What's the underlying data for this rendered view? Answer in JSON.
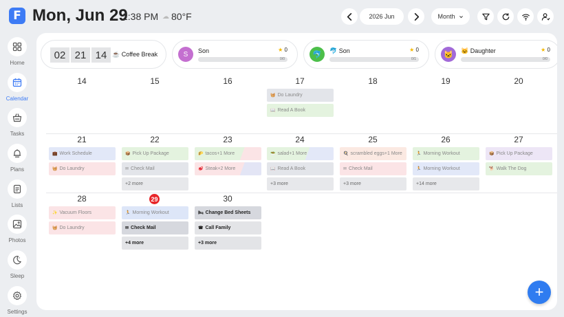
{
  "app": {
    "logo_letter": "F"
  },
  "header": {
    "date": "Mon, Jun 29",
    "time": "2:38 PM",
    "temperature": "80°F",
    "weather_icon": "cloud-icon",
    "month_label": "2026 Jun",
    "view_label": "Month"
  },
  "sidebar": {
    "items": [
      {
        "label": "Home",
        "icon": "grid-icon",
        "active": false
      },
      {
        "label": "Calendar",
        "icon": "calendar-icon",
        "active": true
      },
      {
        "label": "Tasks",
        "icon": "basket-icon",
        "active": false
      },
      {
        "label": "Plans",
        "icon": "bell-icon",
        "active": false
      },
      {
        "label": "Lists",
        "icon": "list-icon",
        "active": false
      },
      {
        "label": "Photos",
        "icon": "photo-icon",
        "active": false
      },
      {
        "label": "Sleep",
        "icon": "moon-icon",
        "active": false
      },
      {
        "label": "Settings",
        "icon": "gear-icon",
        "active": false
      }
    ]
  },
  "timer": {
    "digits": [
      "02",
      "21",
      "14"
    ],
    "label": "☕ Coffee Break"
  },
  "profiles": [
    {
      "initial": "S",
      "name": "Son",
      "stars": "0",
      "progress": "0/0",
      "progress_fraction": 0,
      "color": "#c46fd0"
    },
    {
      "initial": "🐬",
      "name": "🐬 Son",
      "stars": "0",
      "progress": "0/1",
      "progress_fraction": 0,
      "color": "#4cbf4a"
    },
    {
      "initial": "🐱",
      "name": "🐱 Daughter",
      "stars": "0",
      "progress": "0/0",
      "progress_fraction": 0,
      "color": "#a26ad8"
    }
  ],
  "weeks": [
    {
      "days": [
        "14",
        "15",
        "16",
        "17",
        "18",
        "19",
        "20"
      ]
    },
    {
      "days": [
        "21",
        "22",
        "23",
        "24",
        "25",
        "26",
        "27"
      ]
    },
    {
      "days": [
        "28",
        "29",
        "30",
        "",
        "",
        "",
        ""
      ]
    }
  ],
  "today_day": "29",
  "events": [
    {
      "week": 0,
      "day": 3,
      "slot": 0,
      "title": "Do Laundry",
      "icon": "🧺",
      "bg": "#e3e5ea",
      "style": "normal"
    },
    {
      "week": 0,
      "day": 3,
      "slot": 1,
      "title": "Read A Book",
      "icon": "📖",
      "bg": "#e4f3df",
      "style": "normal"
    },
    {
      "week": 1,
      "day": 0,
      "slot": 0,
      "title": "Work Schedule",
      "icon": "💼",
      "bg": "#e2e8f8",
      "style": "normal"
    },
    {
      "week": 1,
      "day": 0,
      "slot": 1,
      "title": "Do Laundry",
      "icon": "🧺",
      "bg": "#fbe4e6",
      "style": "normal"
    },
    {
      "week": 1,
      "day": 1,
      "slot": 0,
      "title": "Pick Up Package",
      "icon": "📦",
      "bg": "#e4f3df",
      "style": "normal"
    },
    {
      "week": 1,
      "day": 1,
      "slot": 1,
      "title": "Check Mail",
      "icon": "✉",
      "bg": "#e3e5ea",
      "style": "normal"
    },
    {
      "week": 1,
      "day": 1,
      "slot": 2,
      "title": "+2 more",
      "icon": "",
      "bg": "#e7e8eb",
      "style": "more"
    },
    {
      "week": 1,
      "day": 2,
      "slot": 0,
      "title": "tacos+1 More",
      "icon": "🌮",
      "bg": "linear-gradient(110deg,#e4f3df 70%,#fbe4e6 70%)",
      "style": "normal"
    },
    {
      "week": 1,
      "day": 2,
      "slot": 1,
      "title": "Steak+2 More",
      "icon": "🥩",
      "bg": "linear-gradient(110deg,#fbe4e6 70%,#e3e5f5 70%)",
      "style": "normal"
    },
    {
      "week": 1,
      "day": 3,
      "slot": 0,
      "title": "salad+1 More",
      "icon": "🥗",
      "bg": "linear-gradient(110deg,#e4f3df 60%,#e3e8f8 60%)",
      "style": "normal"
    },
    {
      "week": 1,
      "day": 3,
      "slot": 1,
      "title": "Read A Book",
      "icon": "📖",
      "bg": "#e3e5ea",
      "style": "normal"
    },
    {
      "week": 1,
      "day": 3,
      "slot": 2,
      "title": "+3 more",
      "icon": "",
      "bg": "#e7e8eb",
      "style": "more"
    },
    {
      "week": 1,
      "day": 4,
      "slot": 0,
      "title": "scrambled eggs+1 More",
      "icon": "🍳",
      "bg": "#fbe9e2",
      "style": "normal"
    },
    {
      "week": 1,
      "day": 4,
      "slot": 1,
      "title": "Check Mail",
      "icon": "✉",
      "bg": "#fbe4e6",
      "style": "normal"
    },
    {
      "week": 1,
      "day": 4,
      "slot": 2,
      "title": "+3 more",
      "icon": "",
      "bg": "#e7e8eb",
      "style": "more"
    },
    {
      "week": 1,
      "day": 5,
      "slot": 0,
      "title": "Morning Workout",
      "icon": "🏃",
      "bg": "#e4f3df",
      "style": "normal"
    },
    {
      "week": 1,
      "day": 5,
      "slot": 1,
      "title": "Morning Workout",
      "icon": "🏃",
      "bg": "#e2e8f8",
      "style": "normal"
    },
    {
      "week": 1,
      "day": 5,
      "slot": 2,
      "title": "+14 more",
      "icon": "",
      "bg": "#e7e8eb",
      "style": "more"
    },
    {
      "week": 1,
      "day": 6,
      "slot": 0,
      "title": "Pick Up Package",
      "icon": "📦",
      "bg": "#ede6f6",
      "style": "normal"
    },
    {
      "week": 1,
      "day": 6,
      "slot": 1,
      "title": "Walk The Dog",
      "icon": "🐕",
      "bg": "#e4f3df",
      "style": "normal"
    },
    {
      "week": 2,
      "day": 0,
      "slot": 0,
      "title": "Vacuum Floors",
      "icon": "✨",
      "bg": "#fbe4e6",
      "style": "normal"
    },
    {
      "week": 2,
      "day": 0,
      "slot": 1,
      "title": "Do Laundry",
      "icon": "🧺",
      "bg": "#fbe4e6",
      "style": "normal"
    },
    {
      "week": 2,
      "day": 1,
      "slot": 0,
      "title": "Morning Workout",
      "icon": "🏃",
      "bg": "#dde6f8",
      "style": "normal"
    },
    {
      "week": 2,
      "day": 1,
      "slot": 1,
      "title": "Check Mail",
      "icon": "✉",
      "bg": "#d6d8de",
      "style": "strong"
    },
    {
      "week": 2,
      "day": 1,
      "slot": 2,
      "title": "+4 more",
      "icon": "",
      "bg": "#e3e4e7",
      "style": "more-strong"
    },
    {
      "week": 2,
      "day": 2,
      "slot": 0,
      "title": "Change Bed Sheets",
      "icon": "🛏",
      "bg": "#d6d8de",
      "style": "strong"
    },
    {
      "week": 2,
      "day": 2,
      "slot": 1,
      "title": "Call Family",
      "icon": "☎",
      "bg": "#e3e4e7",
      "style": "strong"
    },
    {
      "week": 2,
      "day": 2,
      "slot": 2,
      "title": "+3 more",
      "icon": "",
      "bg": "#e3e4e7",
      "style": "more-strong"
    }
  ],
  "fab": {
    "label": "+"
  }
}
